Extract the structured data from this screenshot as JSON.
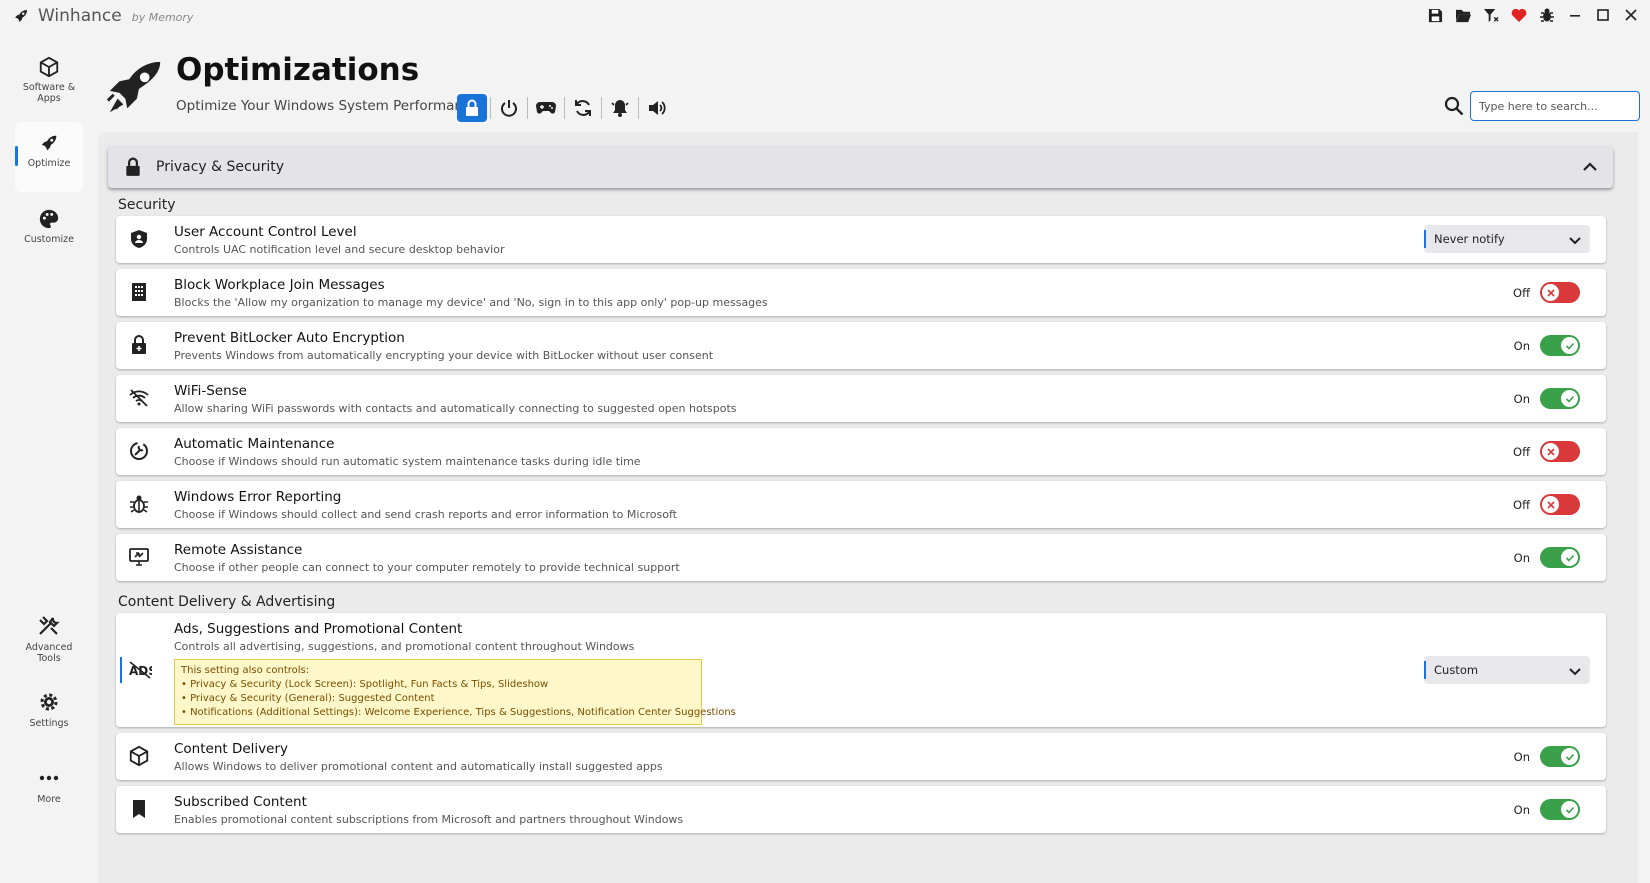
{
  "window": {
    "app_name": "Winhance",
    "app_sub": "by Memory",
    "icons": [
      "save-icon",
      "folder-open-icon",
      "filter-icon",
      "heart-icon",
      "bug-icon",
      "minimize-icon",
      "maximize-icon",
      "close-icon"
    ],
    "heart_color": "#e02424"
  },
  "sidebar": {
    "items": [
      {
        "label": "Software & Apps",
        "icon": "box-icon"
      },
      {
        "label": "Optimize",
        "icon": "rocket-icon"
      },
      {
        "label": "Customize",
        "icon": "palette-icon"
      },
      {
        "label": "Advanced Tools",
        "icon": "tools-icon"
      },
      {
        "label": "Settings",
        "icon": "gear-icon"
      },
      {
        "label": "More",
        "icon": "more-icon"
      }
    ],
    "active": "Optimize"
  },
  "header": {
    "title": "Optimizations",
    "subtitle": "Optimize Your Windows System Performance",
    "categories": [
      "lock-icon",
      "power-icon",
      "gamepad-icon",
      "refresh-icon",
      "bell-icon",
      "speaker-icon"
    ],
    "active_category": "lock-icon",
    "accent": "#1a73d9"
  },
  "search": {
    "placeholder": "Type here to search..."
  },
  "section": {
    "title": "Privacy & Security",
    "groups": {
      "security": "Security",
      "content": "Content Delivery & Advertising"
    }
  },
  "settings": [
    {
      "title": "User Account Control Level",
      "desc": "Controls UAC notification level and secure desktop behavior",
      "icon": "shield-icon",
      "control": "select",
      "value": "Never notify"
    },
    {
      "title": "Block Workplace Join Messages",
      "desc": "Blocks the 'Allow my organization to manage my device' and 'No, sign in to this app only' pop-up messages",
      "icon": "building-icon",
      "control": "toggle",
      "value": "Off"
    },
    {
      "title": "Prevent BitLocker Auto Encryption",
      "desc": "Prevents Windows from automatically encrypting your device with BitLocker without user consent",
      "icon": "lock-plus-icon",
      "control": "toggle",
      "value": "On"
    },
    {
      "title": "WiFi-Sense",
      "desc": "Allow sharing WiFi passwords with contacts and automatically connecting to suggested open hotspots",
      "icon": "wifi-off-icon",
      "control": "toggle",
      "value": "On"
    },
    {
      "title": "Automatic Maintenance",
      "desc": "Choose if Windows should run automatic system maintenance tasks during idle time",
      "icon": "wrench-clock-icon",
      "control": "toggle",
      "value": "Off"
    },
    {
      "title": "Windows Error Reporting",
      "desc": "Choose if Windows should collect and send crash reports and error information to Microsoft",
      "icon": "bug-icon",
      "control": "toggle",
      "value": "Off"
    },
    {
      "title": "Remote Assistance",
      "desc": "Choose if other people can connect to your computer remotely to provide technical support",
      "icon": "remote-desktop-icon",
      "control": "toggle",
      "value": "On"
    },
    {
      "title": "Ads, Suggestions and Promotional Content",
      "desc": "Controls all advertising, suggestions, and promotional content throughout Windows",
      "icon": "ads-off-icon",
      "control": "select",
      "value": "Custom",
      "note": [
        "This setting also controls:",
        "• Privacy & Security (Lock Screen): Spotlight, Fun Facts & Tips, Slideshow",
        "• Privacy & Security (General): Suggested Content",
        "• Notifications (Additional Settings): Welcome Experience, Tips & Suggestions, Notification Center Suggestions"
      ]
    },
    {
      "title": "Content Delivery",
      "desc": "Allows Windows to deliver promotional content and automatically install suggested apps",
      "icon": "package-icon",
      "control": "toggle",
      "value": "On"
    },
    {
      "title": "Subscribed Content",
      "desc": "Enables promotional content subscriptions from Microsoft and partners throughout Windows",
      "icon": "bookmark-icon",
      "control": "toggle",
      "value": "On"
    }
  ],
  "colors": {
    "on": "#3aa04a",
    "off": "#d9393a"
  }
}
